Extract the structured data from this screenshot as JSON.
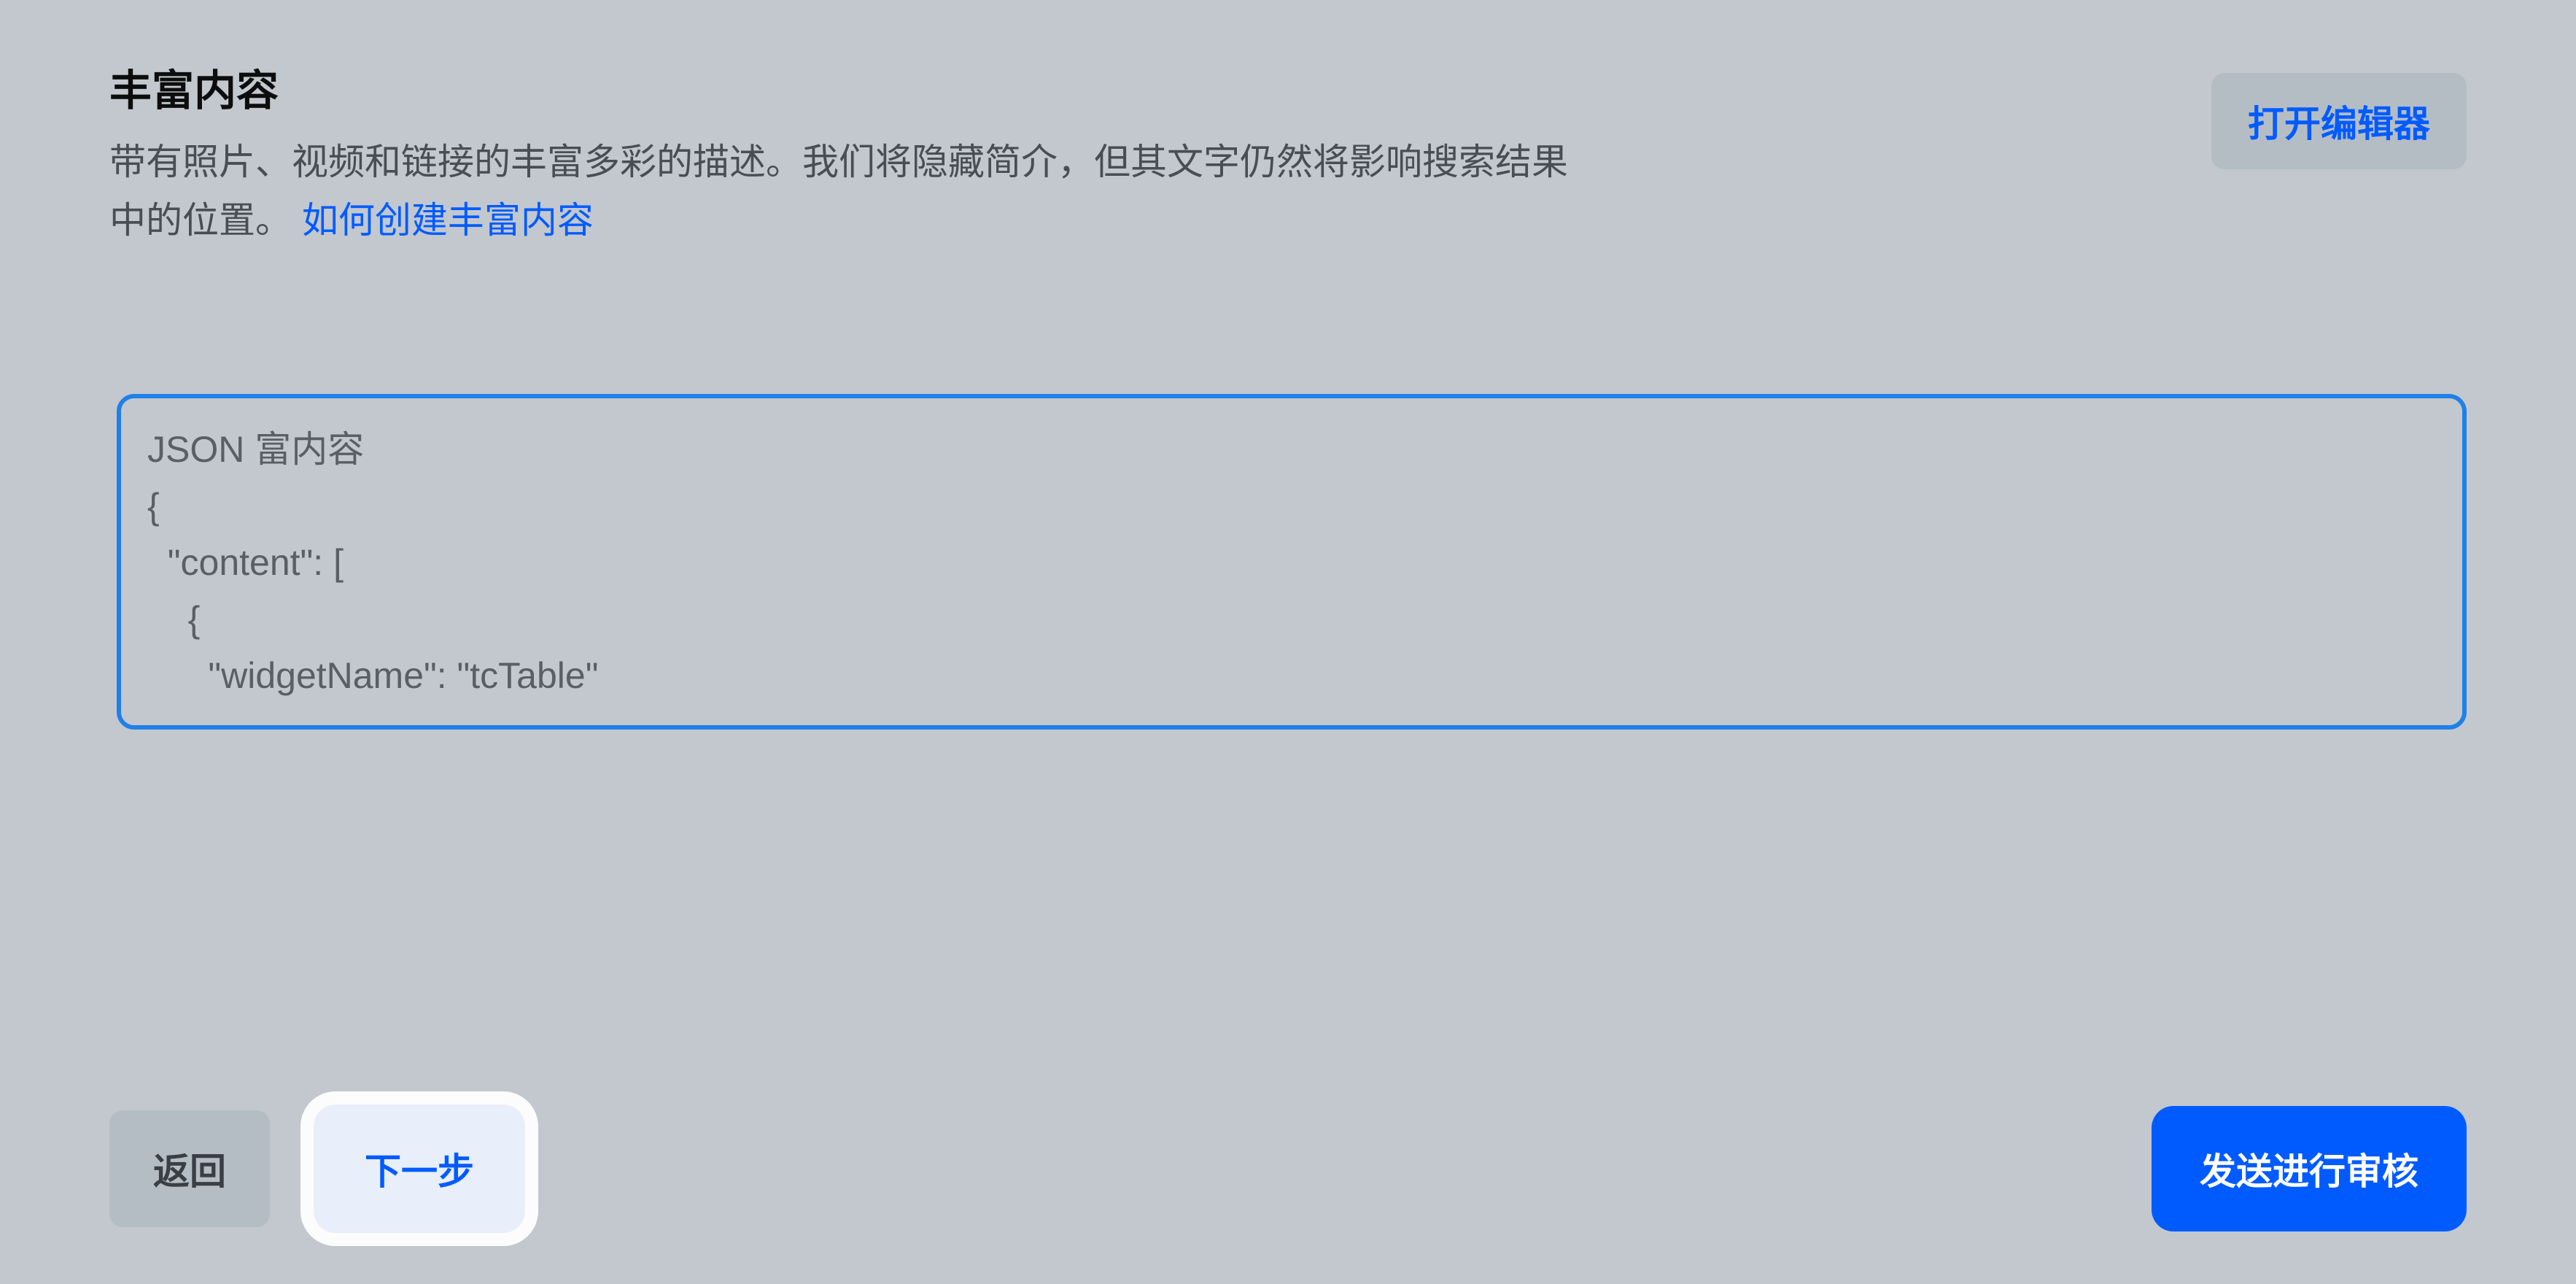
{
  "header": {
    "title": "丰富内容",
    "description_prefix": "带有照片、视频和链接的丰富多彩的描述。我们将隐藏简介，但其文字仍然将影响搜索结果中的位置。 ",
    "help_link_text": "如何创建丰富内容",
    "open_editor_label": "打开编辑器"
  },
  "textarea": {
    "value": "JSON 富内容\n{\n  \"content\": [\n    {\n      \"widgetName\": \"tcTable\""
  },
  "footer": {
    "back_label": "返回",
    "next_label": "下一步",
    "submit_label": "发送进行审核"
  }
}
